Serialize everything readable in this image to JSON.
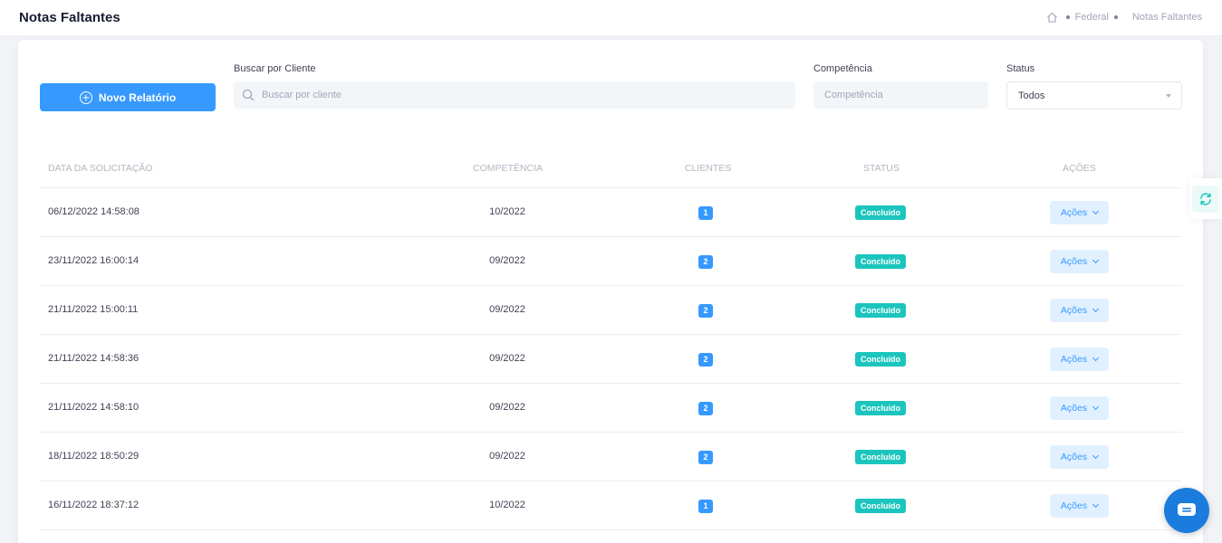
{
  "header": {
    "title": "Notas Faltantes",
    "breadcrumb": {
      "home_icon": "home-icon",
      "level1": "Federal",
      "current": "Notas Faltantes"
    }
  },
  "toolbar": {
    "new_report_label": "Novo Relatório",
    "search": {
      "label": "Buscar por Cliente",
      "placeholder": "Buscar por cliente",
      "value": ""
    },
    "competencia": {
      "label": "Competência",
      "placeholder": "Competência",
      "value": ""
    },
    "status": {
      "label": "Status",
      "selected": "Todos"
    }
  },
  "table": {
    "columns": [
      "Data da Solicitação",
      "Competência",
      "Clientes",
      "Status",
      "Ações"
    ],
    "rows": [
      {
        "date": "06/12/2022 14:58:08",
        "competencia": "10/2022",
        "clientes": "1",
        "status": "Concluído",
        "actions": "Ações"
      },
      {
        "date": "23/11/2022 16:00:14",
        "competencia": "09/2022",
        "clientes": "2",
        "status": "Concluído",
        "actions": "Ações"
      },
      {
        "date": "21/11/2022 15:00:11",
        "competencia": "09/2022",
        "clientes": "2",
        "status": "Concluído",
        "actions": "Ações"
      },
      {
        "date": "21/11/2022 14:58:36",
        "competencia": "09/2022",
        "clientes": "2",
        "status": "Concluído",
        "actions": "Ações"
      },
      {
        "date": "21/11/2022 14:58:10",
        "competencia": "09/2022",
        "clientes": "2",
        "status": "Concluído",
        "actions": "Ações"
      },
      {
        "date": "18/11/2022 18:50:29",
        "competencia": "09/2022",
        "clientes": "2",
        "status": "Concluído",
        "actions": "Ações"
      },
      {
        "date": "16/11/2022 18:37:12",
        "competencia": "10/2022",
        "clientes": "1",
        "status": "Concluído",
        "actions": "Ações"
      }
    ]
  },
  "colors": {
    "primary": "#3699ff",
    "success": "#1bc5bd",
    "light_primary": "#e1f0ff",
    "chat": "#1a7cdd"
  },
  "icons": {
    "side_toggle": "refresh-icon",
    "chat": "chat-icon",
    "search": "search-icon",
    "add": "plus-circle-icon"
  }
}
